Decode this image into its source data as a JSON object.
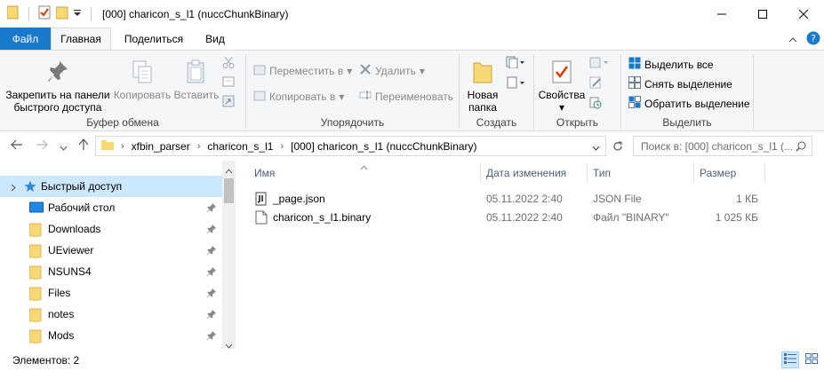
{
  "window": {
    "title": "[000] charicon_s_l1 (nuccChunkBinary)"
  },
  "tabs": {
    "file": "Файл",
    "home": "Главная",
    "share": "Поделиться",
    "view": "Вид"
  },
  "ribbon": {
    "clipboard": {
      "pin_label": "Закрепить на панели быстрого доступа",
      "pin_line1": "Закрепить на панели",
      "pin_line2": "быстрого доступа",
      "copy": "Копировать",
      "paste": "Вставить",
      "group": "Буфер обмена"
    },
    "organize": {
      "move_to": "Переместить в",
      "copy_to": "Копировать в",
      "delete": "Удалить",
      "rename": "Переименовать",
      "group": "Упорядочить"
    },
    "new": {
      "new_folder_line1": "Новая",
      "new_folder_line2": "папка",
      "group": "Создать"
    },
    "open": {
      "properties": "Свойства",
      "group": "Открыть"
    },
    "select": {
      "select_all": "Выделить все",
      "select_none": "Снять выделение",
      "invert": "Обратить выделение",
      "group": "Выделить"
    }
  },
  "address": {
    "crumbs": [
      "xfbin_parser",
      "charicon_s_l1",
      "[000] charicon_s_l1 (nuccChunkBinary)"
    ],
    "search_placeholder": "Поиск в: [000] charicon_s_l1 (..."
  },
  "nav": {
    "quick_access": "Быстрый доступ",
    "items": [
      {
        "label": "Рабочий стол",
        "icon": "desktop-icon"
      },
      {
        "label": "Downloads",
        "icon": "folder-icon"
      },
      {
        "label": "UEviewer",
        "icon": "folder-icon"
      },
      {
        "label": "NSUNS4",
        "icon": "folder-icon"
      },
      {
        "label": "Files",
        "icon": "folder-icon"
      },
      {
        "label": "notes",
        "icon": "folder-icon"
      },
      {
        "label": "Mods",
        "icon": "folder-icon"
      }
    ]
  },
  "files": {
    "columns": {
      "name": "Имя",
      "date": "Дата изменения",
      "type": "Тип",
      "size": "Размер"
    },
    "rows": [
      {
        "name": "_page.json",
        "date": "05.11.2022 2:40",
        "type": "JSON File",
        "size": "1 КБ"
      },
      {
        "name": "charicon_s_l1.binary",
        "date": "05.11.2022 2:40",
        "type": "Файл \"BINARY\"",
        "size": "1 025 КБ"
      }
    ]
  },
  "status": {
    "count": "Элементов: 2"
  },
  "colors": {
    "accent": "#1979ca",
    "selection": "#cce8ff",
    "folder": "#f8d775"
  }
}
